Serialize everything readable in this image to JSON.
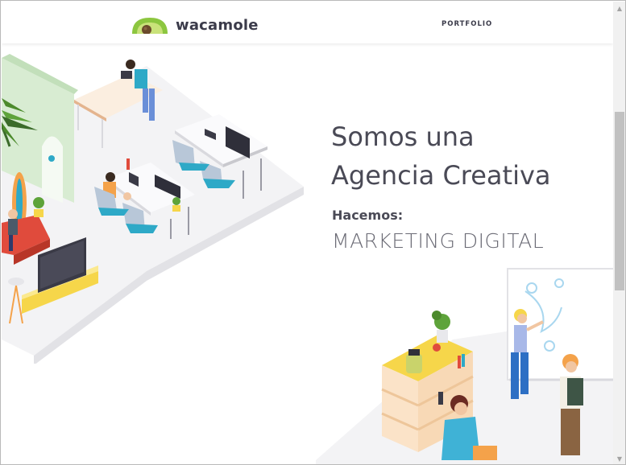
{
  "header": {
    "logo_text": "wacamole",
    "nav": {
      "portfolio_label": "PORTFOLIO"
    }
  },
  "hero": {
    "title_line1": "Somos una",
    "title_line2": "Agencia Creativa",
    "subtitle": "Hacemos:",
    "service": "MARKETING DIGITAL"
  },
  "colors": {
    "text_dark": "#4a4a56",
    "avocado_green": "#8cc63f",
    "avocado_dark": "#3b6b2a",
    "floor_gray": "#eeeef0",
    "accent_teal": "#2ea9c7",
    "accent_yellow": "#f6d64a",
    "accent_red": "#e04b3c"
  },
  "icons": {
    "logo": "avocado-logo-icon",
    "scroll_up": "triangle-up-icon",
    "scroll_down": "triangle-down-icon"
  }
}
